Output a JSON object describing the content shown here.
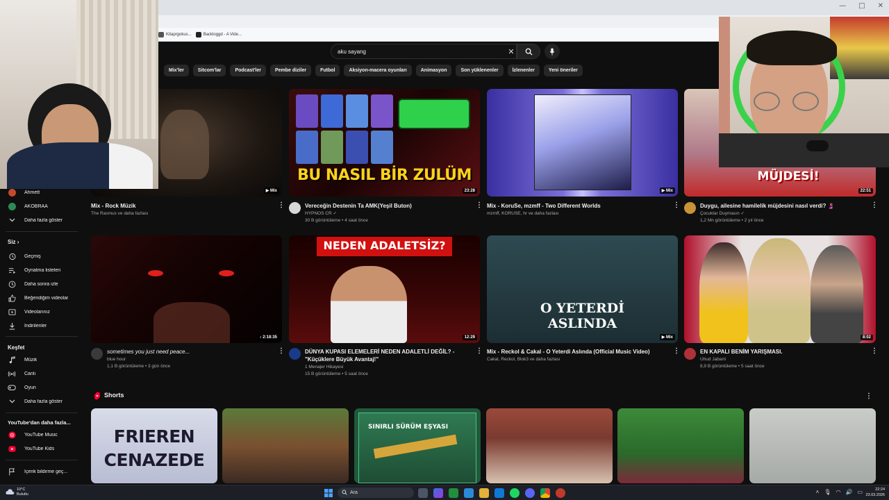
{
  "browser": {
    "bookmarks": [
      "Kitaprgokus...",
      "Backloggd - A Vide..."
    ],
    "window_controls": [
      "—",
      "□",
      "✕"
    ]
  },
  "search": {
    "query": "aku sayang"
  },
  "chips": [
    "Mix'ler",
    "Sitcom'lar",
    "Podcast'ler",
    "Pembe diziler",
    "Futbol",
    "Aksiyon-macera oyunları",
    "Animasyon",
    "Son yüklenenler",
    "İzlenenler",
    "Yeni öneriler"
  ],
  "sidebar": {
    "subscriptions": [
      {
        "label": "Ahmett",
        "color": "#c44a2c"
      },
      {
        "label": "AKOBRAA",
        "color": "#2e8b57"
      }
    ],
    "show_more": "Daha fazla göster",
    "you_title": "Siz",
    "you_items": [
      "Geçmiş",
      "Oynatma listeleri",
      "Daha sonra izle",
      "Beğendiğim videolar",
      "Videolarınız",
      "İndirilenler"
    ],
    "explore_title": "Keşfet",
    "explore_items": [
      "Müzik",
      "Canlı",
      "Oyun"
    ],
    "explore_more": "Daha fazla göster",
    "more_title": "YouTube'dan daha fazla...",
    "more_items": [
      "YouTube Music",
      "YouTube Kids"
    ],
    "report": "İçerik bildirme geç..."
  },
  "videos_row1": [
    {
      "title": "Mix - Rock Müzik",
      "meta1": "The Rasmus ve daha fazlası",
      "meta2": "",
      "badge": "▶ Mix"
    },
    {
      "title": "Vereceğin Destenin Ta AMK(Yeşil Buton)",
      "meta1": "HYPNOS CR ✓",
      "meta2": "30 B görüntüleme • 4 saat önce",
      "badge": "23:28",
      "thumb_text": "BU NASIL BİR ZULÜM"
    },
    {
      "title": "Mix - KoruSe, mzmff - Two Different Worlds",
      "meta1": "mzmff, KORUSE, hr ve daha fazlası",
      "meta2": "",
      "badge": "▶ Mix"
    },
    {
      "title": "Duygu, ailesine hamilelik müjdesini nasıl verdi? 🤰",
      "meta1": "Çocuklar Duymasın ✓",
      "meta2": "1,2 Mn görüntüleme • 2 yıl önce",
      "badge": "22:51",
      "thumb_text": "MÜJDESİ!"
    }
  ],
  "videos_row2": [
    {
      "title": "sometimes you just need peace...",
      "meta1": "blue hour",
      "meta2": "1,1 B görüntüleme • 3 gün önce",
      "badge": "♪ 2:18:35"
    },
    {
      "title": "DÜNYA KUPASI ELEMELERİ NEDEN ADALETLİ DEĞİL? - \"Küçüklere Büyük Avantaj!\"",
      "meta1": "1 Menajer Hikayesi",
      "meta2": "15 B görüntüleme • 5 saat önce",
      "badge": "12:29",
      "thumb_text": "NEDEN ADALETSİZ?"
    },
    {
      "title": "Mix - Reckol & Cakal - O Yeterdi Aslında (Official Music Video)",
      "meta1": "Cakal, Reckol, Blok3 ve daha fazlası",
      "meta2": "",
      "badge": "▶ Mix",
      "thumb_text": "O YETERDİ ASLINDA"
    },
    {
      "title": "EN KAPALI BENİM YARIŞMASI.",
      "meta1": "Uhud Jabarri",
      "meta2": "8,9 B görüntüleme • 5 saat önce",
      "badge": "8:02"
    }
  ],
  "shorts": {
    "title": "Shorts",
    "items": [
      {
        "text": "FRIEREN CENAZEDE"
      },
      {
        "text": ""
      },
      {
        "text": "SINIRLI SÜRÜM EŞYASI"
      },
      {
        "text": ""
      },
      {
        "text": ""
      },
      {
        "text": ""
      }
    ]
  },
  "taskbar": {
    "weather_temp": "10°C",
    "weather_desc": "Bulutlu",
    "search": "Ara",
    "time": "22:24",
    "date": "23.03.2026"
  },
  "colors": {
    "bg": "#0f0f0f",
    "chip": "#272727",
    "youtube_red": "#ff0033"
  }
}
